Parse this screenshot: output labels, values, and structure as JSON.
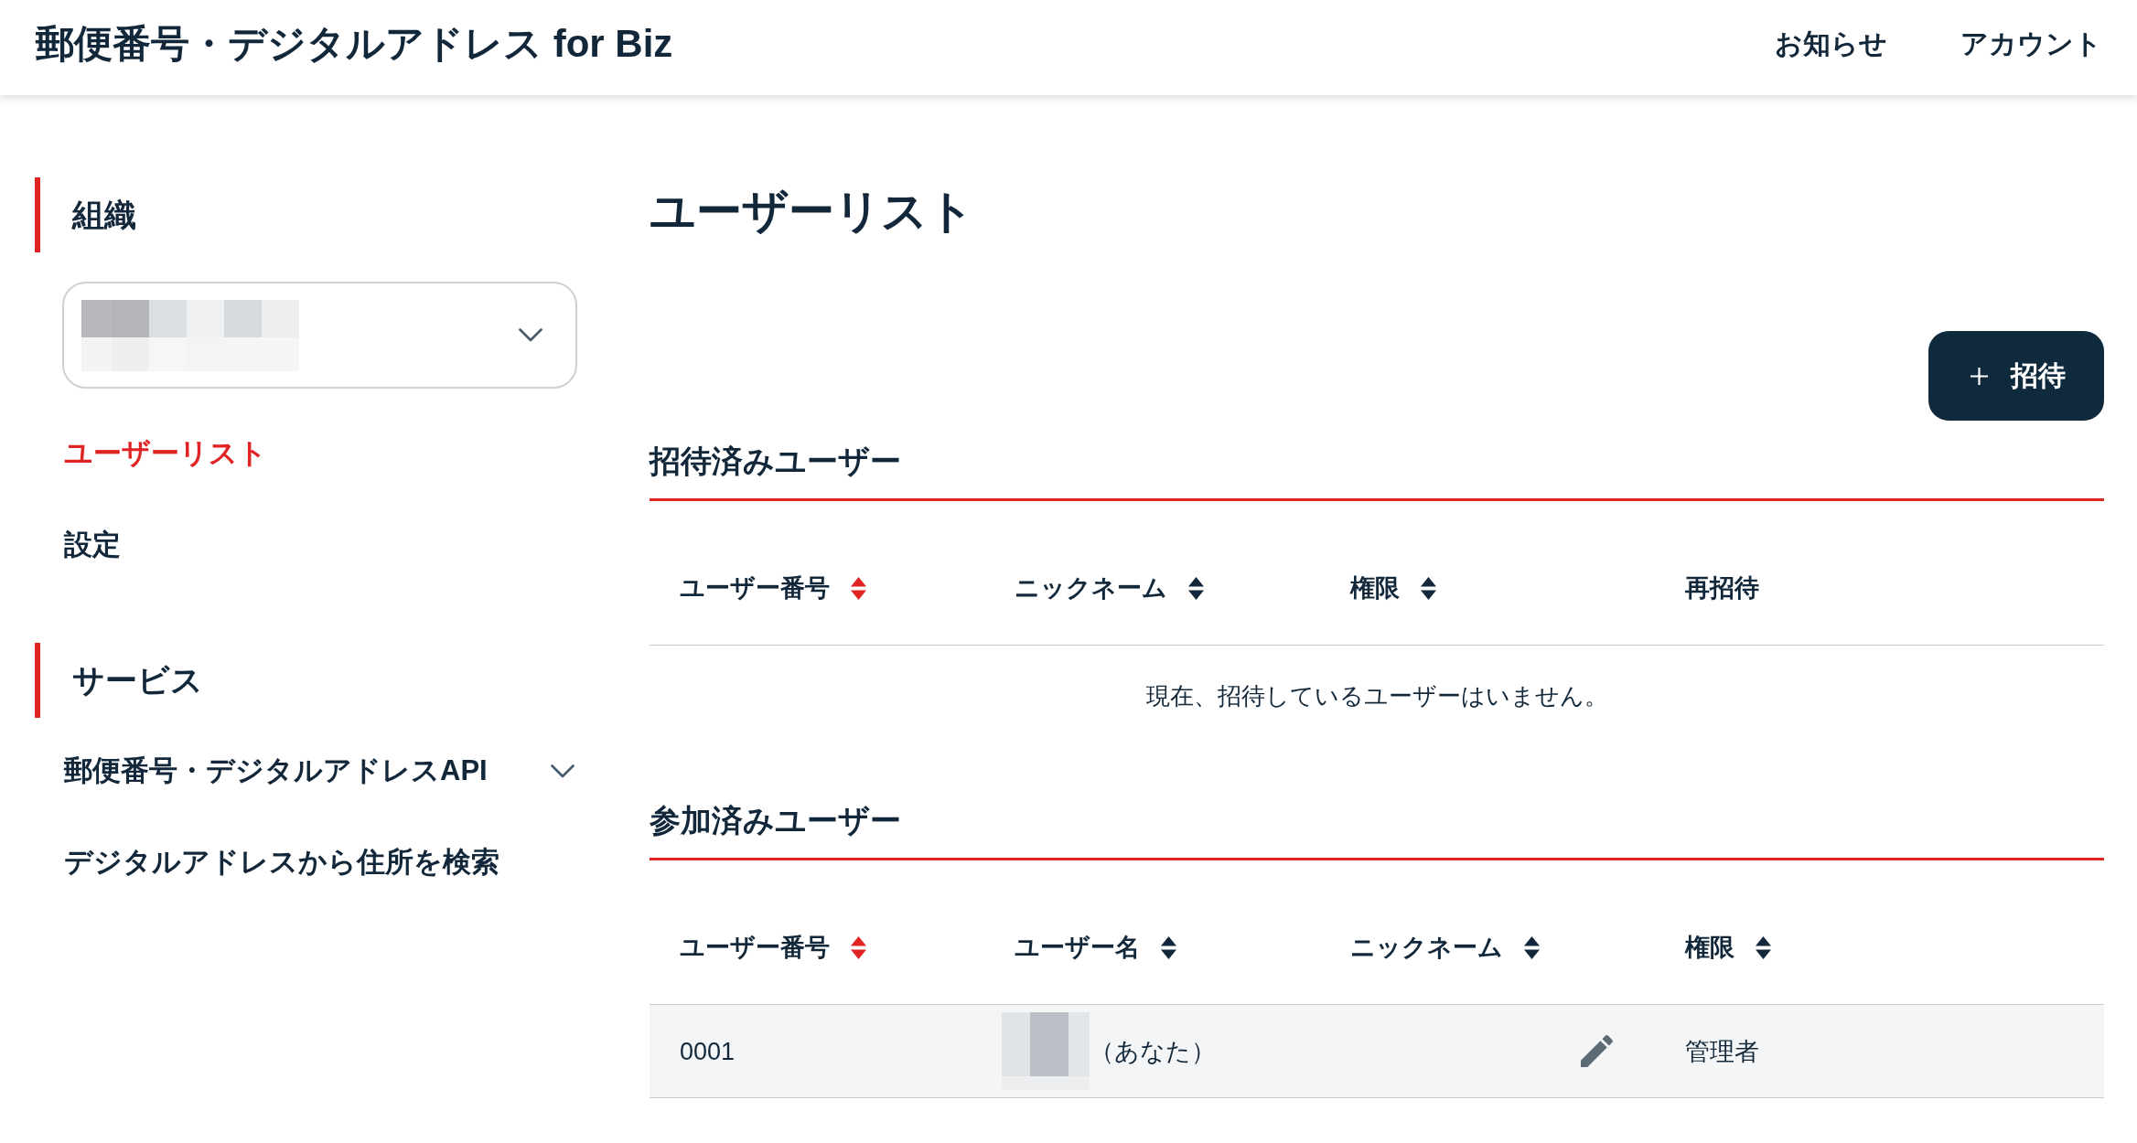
{
  "header": {
    "title": "郵便番号・デジタルアドレス for Biz",
    "links": [
      {
        "label": "お知らせ"
      },
      {
        "label": "アカウント"
      }
    ]
  },
  "sidebar": {
    "sections": [
      {
        "heading": "組織",
        "organization_select": {
          "masked": true
        },
        "items": [
          {
            "kind": "link",
            "label": "ユーザーリスト",
            "selected": true
          },
          {
            "kind": "link",
            "label": "設定",
            "selected": false
          }
        ]
      },
      {
        "heading": "サービス",
        "items": [
          {
            "kind": "group",
            "label": "郵便番号・デジタルアドレスAPI",
            "selected": false,
            "expanded": false
          },
          {
            "kind": "link",
            "label": "デジタルアドレスから住所を検索",
            "selected": false
          }
        ]
      }
    ]
  },
  "main": {
    "title": "ユーザーリスト",
    "invite_button": {
      "label": "招待"
    },
    "invited_users": {
      "heading": "招待済みユーザー",
      "columns": [
        {
          "label": "ユーザー番号",
          "sortable": true,
          "sorted": true
        },
        {
          "label": "ニックネーム",
          "sortable": true,
          "sorted": false
        },
        {
          "label": "権限",
          "sortable": true,
          "sorted": false
        },
        {
          "label": "再招待",
          "sortable": false,
          "sorted": false
        }
      ],
      "empty_message": "現在、招待しているユーザーはいません。"
    },
    "joined_users": {
      "heading": "参加済みユーザー",
      "columns": [
        {
          "label": "ユーザー番号",
          "sortable": true,
          "sorted": true
        },
        {
          "label": "ユーザー名",
          "sortable": true,
          "sorted": false
        },
        {
          "label": "ニックネーム",
          "sortable": true,
          "sorted": false
        },
        {
          "label": "権限",
          "sortable": true,
          "sorted": false
        }
      ],
      "rows": [
        {
          "cells": [
            {
              "kind": "text",
              "text": "0001"
            },
            {
              "kind": "masked_name",
              "text": "（あなた）"
            },
            {
              "kind": "nickname",
              "editable": true
            },
            {
              "kind": "text",
              "text": "管理者"
            }
          ]
        }
      ]
    }
  }
}
